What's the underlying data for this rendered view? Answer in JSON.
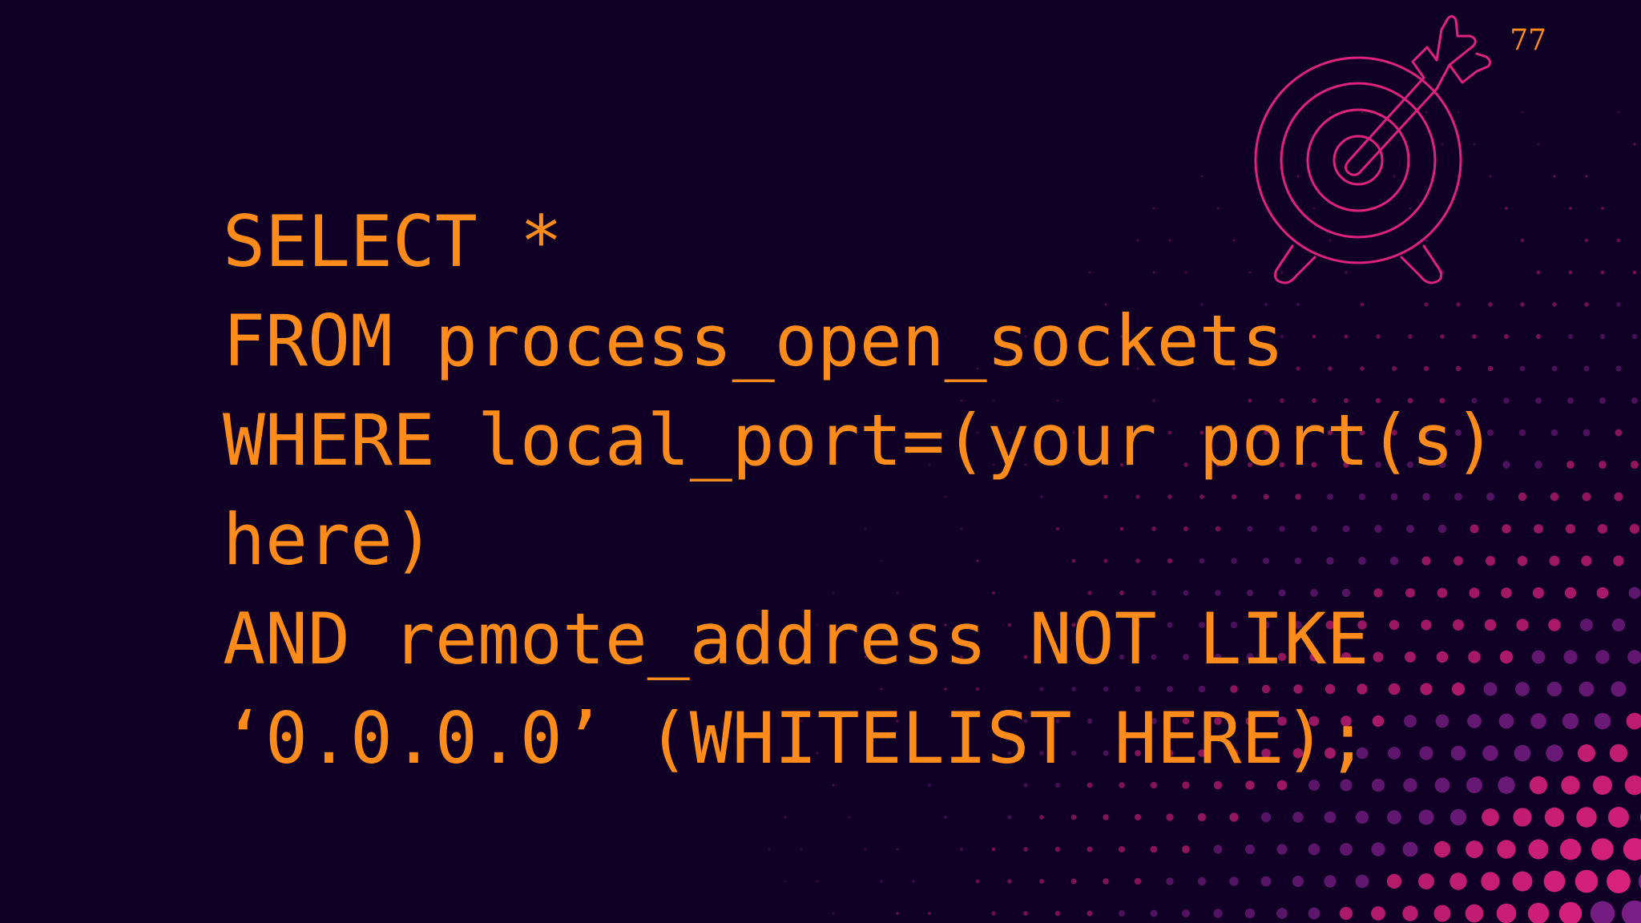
{
  "slide": {
    "page_number": "77",
    "icon": "target-with-arrow-icon",
    "colors": {
      "background": "#100025",
      "code_text": "#ff8c1a",
      "icon_stroke": "#e0227f",
      "dot_magenta": "#e0227f",
      "dot_purple": "#7a1e86"
    }
  },
  "code": {
    "lines": [
      "SELECT *",
      "FROM process_open_sockets",
      "WHERE local_port=(your port(s)",
      "here)",
      "AND remote_address NOT LIKE",
      "‘0.0.0.0’ (WHITELIST HERE);"
    ]
  }
}
